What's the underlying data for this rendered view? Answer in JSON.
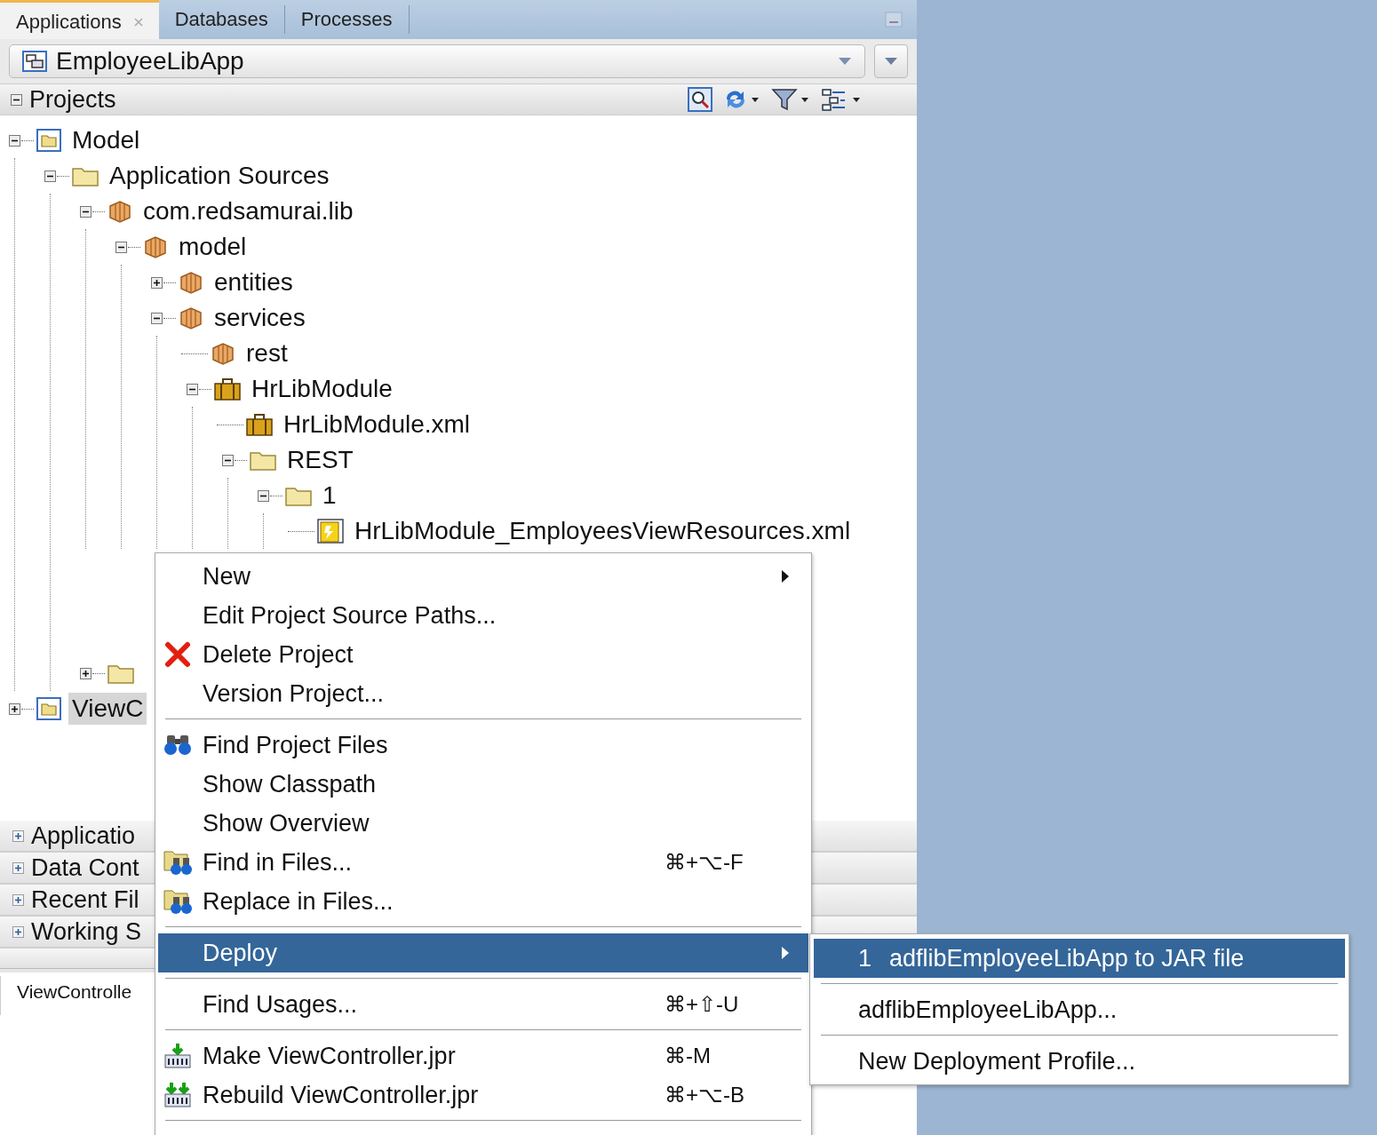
{
  "tabs": [
    {
      "label": "Applications",
      "selected": true,
      "closable": true
    },
    {
      "label": "Databases",
      "selected": false,
      "closable": false
    },
    {
      "label": "Processes",
      "selected": false,
      "closable": false
    }
  ],
  "application_selector": {
    "value": "EmployeeLibApp"
  },
  "projects_panel": {
    "title": "Projects",
    "expanded": true,
    "tree": [
      {
        "label": "Model",
        "kind": "project",
        "expanded": true,
        "selected": false,
        "children": [
          {
            "label": "Application Sources",
            "kind": "folder",
            "expanded": true,
            "selected": false,
            "children": [
              {
                "label": "com.redsamurai.lib",
                "kind": "package",
                "expanded": true,
                "selected": false,
                "children": [
                  {
                    "label": "model",
                    "kind": "package",
                    "expanded": true,
                    "selected": false,
                    "children": [
                      {
                        "label": "entities",
                        "kind": "package",
                        "expanded": false,
                        "selected": false
                      },
                      {
                        "label": "services",
                        "kind": "package",
                        "expanded": true,
                        "selected": false,
                        "children": [
                          {
                            "label": "rest",
                            "kind": "package",
                            "selected": false
                          },
                          {
                            "label": "HrLibModule",
                            "kind": "module",
                            "expanded": true,
                            "selected": false,
                            "children": [
                              {
                                "label": "HrLibModule.xml",
                                "kind": "module",
                                "selected": false
                              },
                              {
                                "label": "REST",
                                "kind": "folder",
                                "expanded": true,
                                "selected": false,
                                "children": [
                                  {
                                    "label": "1",
                                    "kind": "folder",
                                    "expanded": true,
                                    "selected": false,
                                    "children": [
                                      {
                                        "label": "HrLibModule_EmployeesViewResources.xml",
                                        "kind": "resource",
                                        "selected": false
                                      }
                                    ]
                                  }
                                ]
                              }
                            ]
                          }
                        ]
                      }
                    ]
                  }
                ]
              },
              {
                "kind": "folder",
                "expanded": false
              }
            ]
          }
        ]
      },
      {
        "label": "ViewC",
        "kind": "project",
        "expanded": false,
        "selected": true
      }
    ]
  },
  "accordion": [
    {
      "label": "Applicatio",
      "expanded": false
    },
    {
      "label": "Data Cont",
      "expanded": false
    },
    {
      "label": "Recent Fil",
      "expanded": false
    },
    {
      "label": "Working S",
      "expanded": false
    }
  ],
  "bottom_tab": {
    "label": "ViewControlle"
  },
  "context_menu": {
    "items": [
      {
        "kind": "item",
        "label": "New",
        "has_submenu": true,
        "selected": false
      },
      {
        "kind": "item",
        "label": "Edit Project Source Paths...",
        "selected": false
      },
      {
        "kind": "delete",
        "label": "Delete Project",
        "selected": false
      },
      {
        "kind": "item",
        "label": "Version Project...",
        "selected": false
      },
      {
        "kind": "separator"
      },
      {
        "kind": "binoculars",
        "label": "Find Project Files",
        "selected": false
      },
      {
        "kind": "item",
        "label": "Show Classpath",
        "selected": false
      },
      {
        "kind": "item",
        "label": "Show Overview",
        "selected": false
      },
      {
        "kind": "folder-binoculars",
        "label": "Find in Files...",
        "shortcut": "⌘+⌥-F",
        "selected": false
      },
      {
        "kind": "folder-binoculars",
        "label": "Replace in Files...",
        "selected": false
      },
      {
        "kind": "separator"
      },
      {
        "kind": "item",
        "label": "Deploy",
        "has_submenu": true,
        "selected": true
      },
      {
        "kind": "separator"
      },
      {
        "kind": "item",
        "label": "Find Usages...",
        "shortcut": "⌘+⇧-U",
        "selected": false
      },
      {
        "kind": "separator"
      },
      {
        "kind": "make",
        "label": "Make ViewController.jpr",
        "shortcut": "⌘-M",
        "selected": false
      },
      {
        "kind": "rebuild",
        "label": "Rebuild ViewController.jpr",
        "shortcut": "⌘+⌥-B",
        "selected": false
      },
      {
        "kind": "separator"
      }
    ]
  },
  "deploy_submenu": {
    "items": [
      {
        "kind": "item",
        "number": "1",
        "label": "adflibEmployeeLibApp to JAR file",
        "selected": true
      },
      {
        "kind": "separator"
      },
      {
        "kind": "item",
        "label": "adflibEmployeeLibApp...",
        "selected": false
      },
      {
        "kind": "separator"
      },
      {
        "kind": "item",
        "label": "New Deployment Profile...",
        "selected": false
      }
    ]
  }
}
